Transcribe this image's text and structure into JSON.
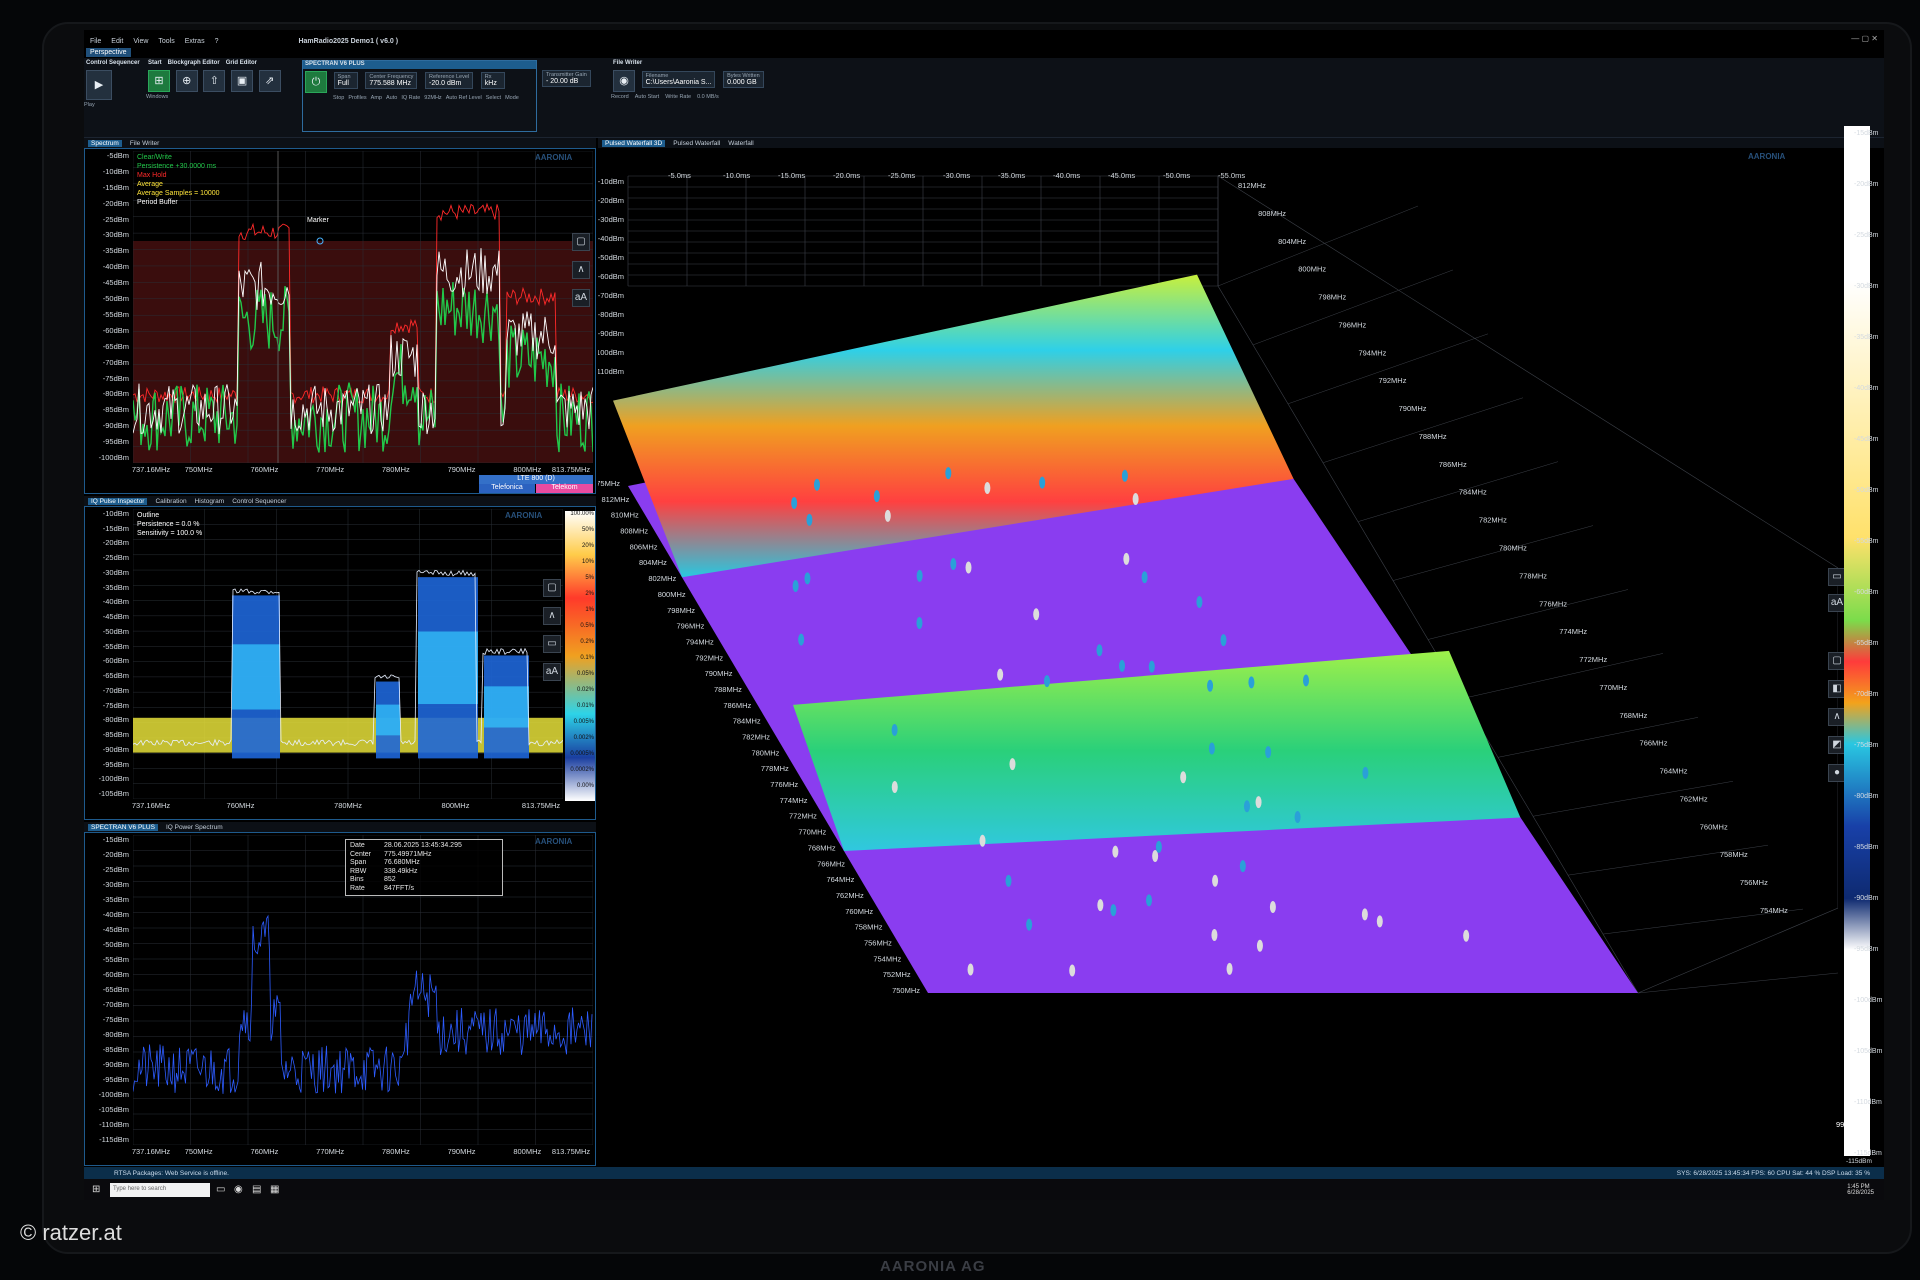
{
  "menu": {
    "items": [
      "File",
      "Edit",
      "View",
      "Tools",
      "Extras",
      "?"
    ],
    "title": "HamRadio2025 Demo1 ( v6.0 )"
  },
  "perspective_tab": "Perspective",
  "ribbon": {
    "control_sequencer": {
      "title": "Control Sequencer",
      "play": "Play"
    },
    "start_tabs": [
      "Start",
      "Blockgraph Editor",
      "Grid Editor"
    ],
    "windows_label": "Windows",
    "spectran": {
      "title": "SPECTRAN V6 PLUS",
      "stop": "Stop",
      "span_label": "Span",
      "span_value": "Full",
      "profiles": "Profiles",
      "amp_label": "Amp",
      "amp_value": "Auto",
      "center_label": "Center Frequency",
      "center_value": "775.588 MHz",
      "ref_label": "Reference Level",
      "ref_value": "-20.0 dBm",
      "rbw_label": "Rx",
      "rbw_value": "kHz",
      "iq_rate_label": "IQ Rate",
      "iq_rate_value": "92MHz",
      "auto_ref": "Auto Ref Level",
      "select": "Select",
      "mode": "Mode",
      "trans_gain_label": "Transmitter Gain",
      "trans_gain_value": "- 20.00 dB"
    },
    "file_writer": {
      "title": "File Writer",
      "filename_label": "Filename",
      "filename_value": "C:\\Users\\Aaronia S...",
      "record": "Record",
      "auto_start": "Auto Start",
      "bytes_written_label": "Bytes Written",
      "bytes_written_value": "0.000 GB",
      "write_rate_label": "Write Rate",
      "write_rate_value": "0.0 MB/s"
    }
  },
  "tabs": {
    "top_left": [
      "Spectrum",
      "File Writer"
    ],
    "middle_left": [
      "IQ Pulse Inspector",
      "Calibration",
      "Histogram",
      "Control Sequencer"
    ],
    "bottom_left": [
      "SPECTRAN V6 PLUS",
      "IQ Power Spectrum"
    ],
    "right": [
      "Pulsed Waterfall 3D",
      "Pulsed Waterfall",
      "Waterfall"
    ]
  },
  "spectrum": {
    "y_ticks": [
      "-5dBm",
      "-10dBm",
      "-15dBm",
      "-20dBm",
      "-25dBm",
      "-30dBm",
      "-35dBm",
      "-40dBm",
      "-45dBm",
      "-50dBm",
      "-55dBm",
      "-60dBm",
      "-65dBm",
      "-70dBm",
      "-75dBm",
      "-80dBm",
      "-85dBm",
      "-90dBm",
      "-95dBm",
      "-100dBm"
    ],
    "x_ticks": [
      "737.16MHz",
      "750MHz",
      "760MHz",
      "770MHz",
      "780MHz",
      "790MHz",
      "800MHz",
      "813.75MHz"
    ],
    "legend": {
      "clear_write": "Clear/Write",
      "persistence": "Persistence  +30.0000 ms",
      "max_hold": "Max Hold",
      "average": "Average",
      "avg_samples": "Average Samples = 10000",
      "period_buffer": "Period Buffer"
    },
    "marker": "Marker",
    "bands": {
      "band": "LTE 800 (D)",
      "op1": "Telefonica",
      "op2": "Telekom"
    },
    "colors": {
      "clear_write": "#22c84a",
      "max_hold": "#ff2a2a",
      "average": "#ffe53b",
      "buffer": "#ffffff"
    }
  },
  "histogram": {
    "y_ticks": [
      "-10dBm",
      "-15dBm",
      "-20dBm",
      "-25dBm",
      "-30dBm",
      "-35dBm",
      "-40dBm",
      "-45dBm",
      "-50dBm",
      "-55dBm",
      "-60dBm",
      "-65dBm",
      "-70dBm",
      "-75dBm",
      "-80dBm",
      "-85dBm",
      "-90dBm",
      "-95dBm",
      "-100dBm",
      "-105dBm"
    ],
    "x_ticks": [
      "737.16MHz",
      "760MHz",
      "780MHz",
      "800MHz",
      "813.75MHz"
    ],
    "legend": {
      "outline": "Outline",
      "persistence": "Persistence = 0.0 %",
      "sensitivity": "Sensitivity = 100.0 %"
    },
    "scale": [
      "100.00%",
      "50%",
      "20%",
      "10%",
      "5%",
      "2%",
      "1%",
      "0.5%",
      "0.2%",
      "0.1%",
      "0.05%",
      "0.02%",
      "0.01%",
      "0.005%",
      "0.002%",
      "0.0005%",
      "0.0002%",
      "0.00%"
    ]
  },
  "iq_power": {
    "y_ticks": [
      "-15dBm",
      "-20dBm",
      "-25dBm",
      "-30dBm",
      "-35dBm",
      "-40dBm",
      "-45dBm",
      "-50dBm",
      "-55dBm",
      "-60dBm",
      "-65dBm",
      "-70dBm",
      "-75dBm",
      "-80dBm",
      "-85dBm",
      "-90dBm",
      "-95dBm",
      "-100dBm",
      "-105dBm",
      "-110dBm",
      "-115dBm"
    ],
    "x_ticks": [
      "737.16MHz",
      "750MHz",
      "760MHz",
      "770MHz",
      "780MHz",
      "790MHz",
      "800MHz",
      "813.75MHz"
    ],
    "info": [
      [
        "Date",
        "28.06.2025 13:45:34.295"
      ],
      [
        "Center",
        "775.49971MHz"
      ],
      [
        "Span",
        "76.680MHz"
      ],
      [
        "RBW",
        "338.49kHz"
      ],
      [
        "Bins",
        "852"
      ],
      [
        "Rate",
        "847FFT/s"
      ]
    ]
  },
  "waterfall": {
    "time_ticks": [
      "-5.0ms",
      "-10.0ms",
      "-15.0ms",
      "-20.0ms",
      "-25.0ms",
      "-30.0ms",
      "-35.0ms",
      "-40.0ms",
      "-45.0ms",
      "-50.0ms",
      "-55.0ms"
    ],
    "freq_left": [
      "813.75MHz",
      "812MHz",
      "810MHz",
      "808MHz",
      "806MHz",
      "804MHz",
      "802MHz",
      "800MHz",
      "798MHz",
      "796MHz",
      "794MHz",
      "792MHz",
      "790MHz",
      "788MHz",
      "786MHz",
      "784MHz",
      "782MHz",
      "780MHz",
      "778MHz",
      "776MHz",
      "774MHz",
      "772MHz",
      "770MHz",
      "768MHz",
      "766MHz",
      "764MHz",
      "762MHz",
      "760MHz",
      "758MHz",
      "756MHz",
      "754MHz",
      "752MHz",
      "750MHz"
    ],
    "freq_right": [
      "812MHz",
      "808MHz",
      "804MHz",
      "800MHz",
      "798MHz",
      "796MHz",
      "794MHz",
      "792MHz",
      "790MHz",
      "788MHz",
      "786MHz",
      "784MHz",
      "782MHz",
      "780MHz",
      "778MHz",
      "776MHz",
      "774MHz",
      "772MHz",
      "770MHz",
      "768MHz",
      "766MHz",
      "764MHz",
      "762MHz",
      "760MHz",
      "758MHz",
      "756MHz",
      "754MHz"
    ],
    "db_left": [
      "-10dBm",
      "-20dBm",
      "-30dBm",
      "-40dBm",
      "-50dBm",
      "-60dBm",
      "-70dBm",
      "-80dBm",
      "-90dBm",
      "-100dBm",
      "-110dBm"
    ],
    "scale_ticks": [
      "-15dBm",
      "-20dBm",
      "-25dBm",
      "-30dBm",
      "-35dBm",
      "-40dBm",
      "-45dBm",
      "-50dBm",
      "-55dBm",
      "-60dBm",
      "-65dBm",
      "-70dBm",
      "-75dBm",
      "-80dBm",
      "-85dBm",
      "-90dBm",
      "-95dBm",
      "-100dBm",
      "-105dBm",
      "-110dBm",
      "-115dBm"
    ],
    "scale_bottom": "-115dBm",
    "range_label": "99.90dB"
  },
  "statusbar": {
    "message": "RTSA Packages: Web Service is offline.",
    "right": "SYS: 6/28/2025 13:45:34    FPS: 60  CPU Sat: 44 %  DSP Load: 35 %"
  },
  "taskbar": {
    "search": "Type here to search",
    "time": "1:45 PM",
    "date": "6/28/2025"
  },
  "watermark": "AARONIA",
  "bezel_brand": "AARONIA AG",
  "credit": "© ratzer.at"
}
